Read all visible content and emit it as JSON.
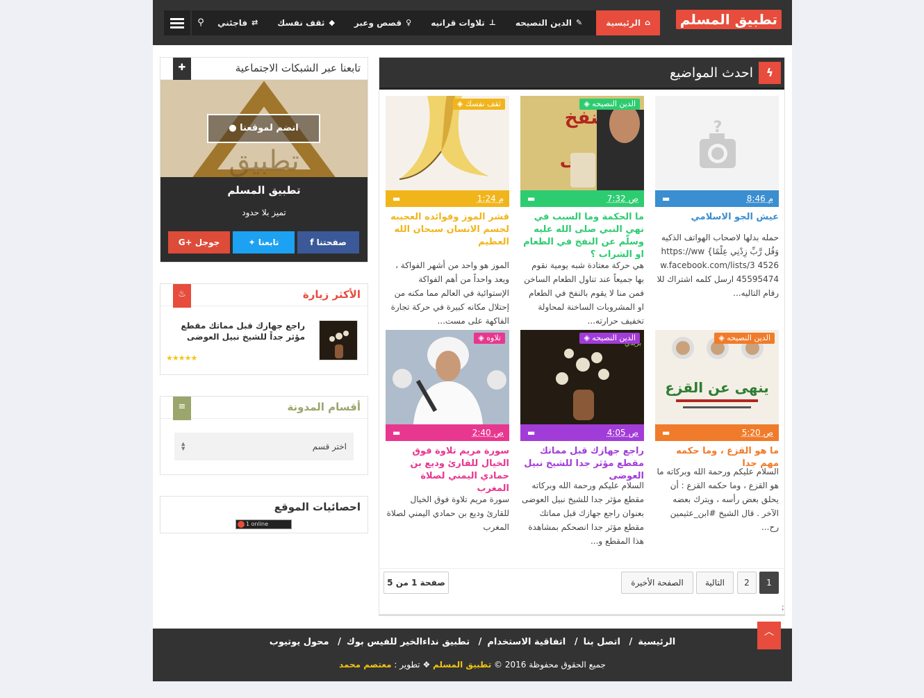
{
  "header": {
    "logo": "تطبيق المسلم",
    "nav": [
      {
        "label": "الرئيسية",
        "icon": "home-icon",
        "active": true
      },
      {
        "label": "الدين النصيحه",
        "icon": "brush-icon"
      },
      {
        "label": "تلاوات قرانيه",
        "icon": "pin-icon"
      },
      {
        "label": "قصص وعبر",
        "icon": "bulb-icon"
      },
      {
        "label": "ثقف نفسك",
        "icon": "graduation-icon"
      },
      {
        "label": "فاجئني",
        "icon": "shuffle-icon"
      }
    ]
  },
  "main": {
    "title": "احدث المواضيع",
    "posts": [
      {
        "title": "عيش الجو الاسلامي",
        "category": "",
        "time": "8:46 م",
        "excerpt": "حمله بدلها لاصحاب الهواتف الذكيه وَقُل رَّبِّ زِدْنِي عِلْمًا} https://www.facebook.com/lists/3 452645595474 ارسل كلمه اشتراك للارقام التاليه...",
        "color": "#3b8ecf"
      },
      {
        "title": "ما الحكمة وما السبب في نهي النبي صلى الله عليه وسلّم عن النفخ في الطعام او الشراب ؟",
        "category": "الدين النصيحه",
        "time": "7:32 ص",
        "excerpt": "هي حركة معتادة شبه يومية نقوم بها جميعاً عند تناول الطعام الساخن فمن منا لا يقوم بالنفخ في الطعام او المشروبات الساخنة لمحاولة تخفيف حرارته...",
        "color": "#2ecc71"
      },
      {
        "title": "قشر الموز وفوائده العجيبه لجسم الانسان سبحان الله العظيم",
        "category": "ثقف نفسك",
        "time": "1:24 م",
        "excerpt": "الموز هو واحد من أشهر الفواكة ، ويعد واحداً من أهم الفواكة الإستوائية في العالم مما مكنه من إحتلال مكانه كبيرة في حركة تجارة الفاكهة على مست...",
        "color": "#f1b51c"
      },
      {
        "title": "ما هو القزع ، وما حكمه مهم جدا",
        "category": "الدين النصيحه",
        "time": "5:20 ص",
        "excerpt": "السلام عليكم ورحمة الله وبركاته  ما هو القزع ، وما حكمه   القزع : أن يحلق بعض رأسه ، ويترك بعضه الآخر .  قال الشيخ #ابن_عثيمين رح...",
        "color": "#f07b2a"
      },
      {
        "title": "راجع جهازك قبل مماتك مقطع مؤثر جدا للشيخ نبيل العوضى",
        "category": "الدين النصيحه",
        "time": "4:05 ص",
        "excerpt": "السلام عليكم ورحمة الله وبركاته مقطع مؤثر جدا للشيخ نبيل العوضى بعنوان راجع جهازك قبل مماتك  مقطع مؤثر جدا انصحكم بمشاهدة  هذا المقطع   و...",
        "color": "#a23cd8"
      },
      {
        "title": "سورة مريم تلاوة فوق الخيال للقارئ وديع بن حمادي اليمني لصلاة المغرب",
        "category": "تلاوه",
        "time": "2:40 ص",
        "excerpt": "سورة مريم تلاوة فوق الخيال للقارئ وديع بن حمادي اليمني لصلاة المغرب",
        "color": "#e8378f"
      }
    ],
    "pagination": {
      "pages": [
        "1",
        "2"
      ],
      "next": "التالية",
      "last": "الصفحة الأخيرة",
      "info": "صفحة 1 من 5"
    }
  },
  "sidebar": {
    "follow": {
      "title": "تابعنا عبر الشبكات الاجتماعية",
      "join": "انضم لموقعنا",
      "name": "تطبيق المسلم",
      "slogan": "تميز بلا حدود",
      "buttons": [
        "صفحتنا",
        "تابعنا",
        "جوجل"
      ]
    },
    "popular": {
      "title": "الأكثر زيارة",
      "item": "راجع جهازك قبل مماتك مقطع مؤثر جداً للشيخ نبيل العوضى",
      "stars": "★★★★★"
    },
    "categories": {
      "title": "أقسام المدونة",
      "select": "اختر قسم"
    },
    "stats": {
      "title": "احصائيات الموقع",
      "online": "1 online"
    }
  },
  "footer": {
    "links": [
      "الرئيسية",
      "اتصل بنا",
      "اتفاقية الاستخدام",
      "تطبيق نداءالخير للفيس بوك",
      "محول يوتيوب"
    ],
    "copy_prefix": "جميع الحقوق محفوظة 2016 ©",
    "site": "تطبيق المسلم",
    "dev_label": "❖ تطوير :",
    "developer": "معتصم محمد"
  },
  "colors": {
    "accent": "#e74c3c",
    "dark": "#333333"
  }
}
